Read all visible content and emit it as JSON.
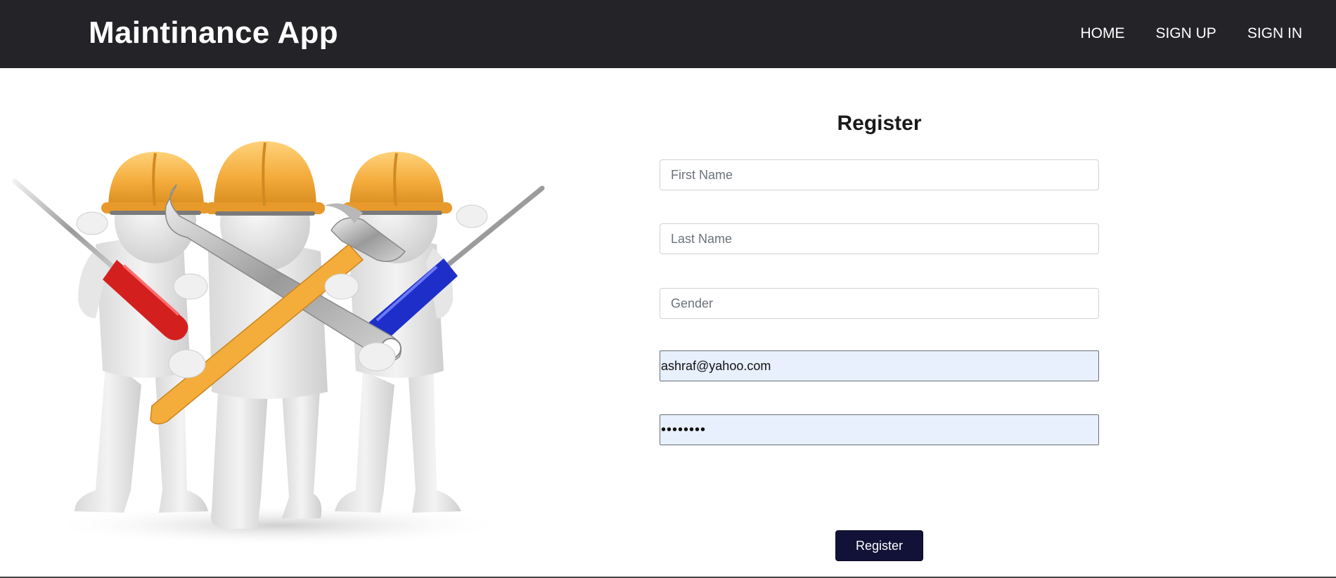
{
  "navbar": {
    "brand": "Maintinance App",
    "links": [
      {
        "label": "HOME"
      },
      {
        "label": "SIGN UP"
      },
      {
        "label": "SIGN IN"
      }
    ]
  },
  "hero": {
    "image": "three-workers-with-tools-illustration"
  },
  "register": {
    "title": "Register",
    "fields": {
      "first_name": {
        "placeholder": "First Name",
        "value": ""
      },
      "last_name": {
        "placeholder": "Last Name",
        "value": ""
      },
      "gender": {
        "placeholder": "Gender",
        "value": ""
      },
      "email": {
        "placeholder": "",
        "value": "ashraf@yahoo.com"
      },
      "password": {
        "placeholder": "",
        "value": "********"
      }
    },
    "submit_label": "Register"
  },
  "colors": {
    "navbar_bg": "#242327",
    "button_bg": "#121137",
    "autofill_bg": "#e8f0fe",
    "helmet": "#f2a93b"
  }
}
